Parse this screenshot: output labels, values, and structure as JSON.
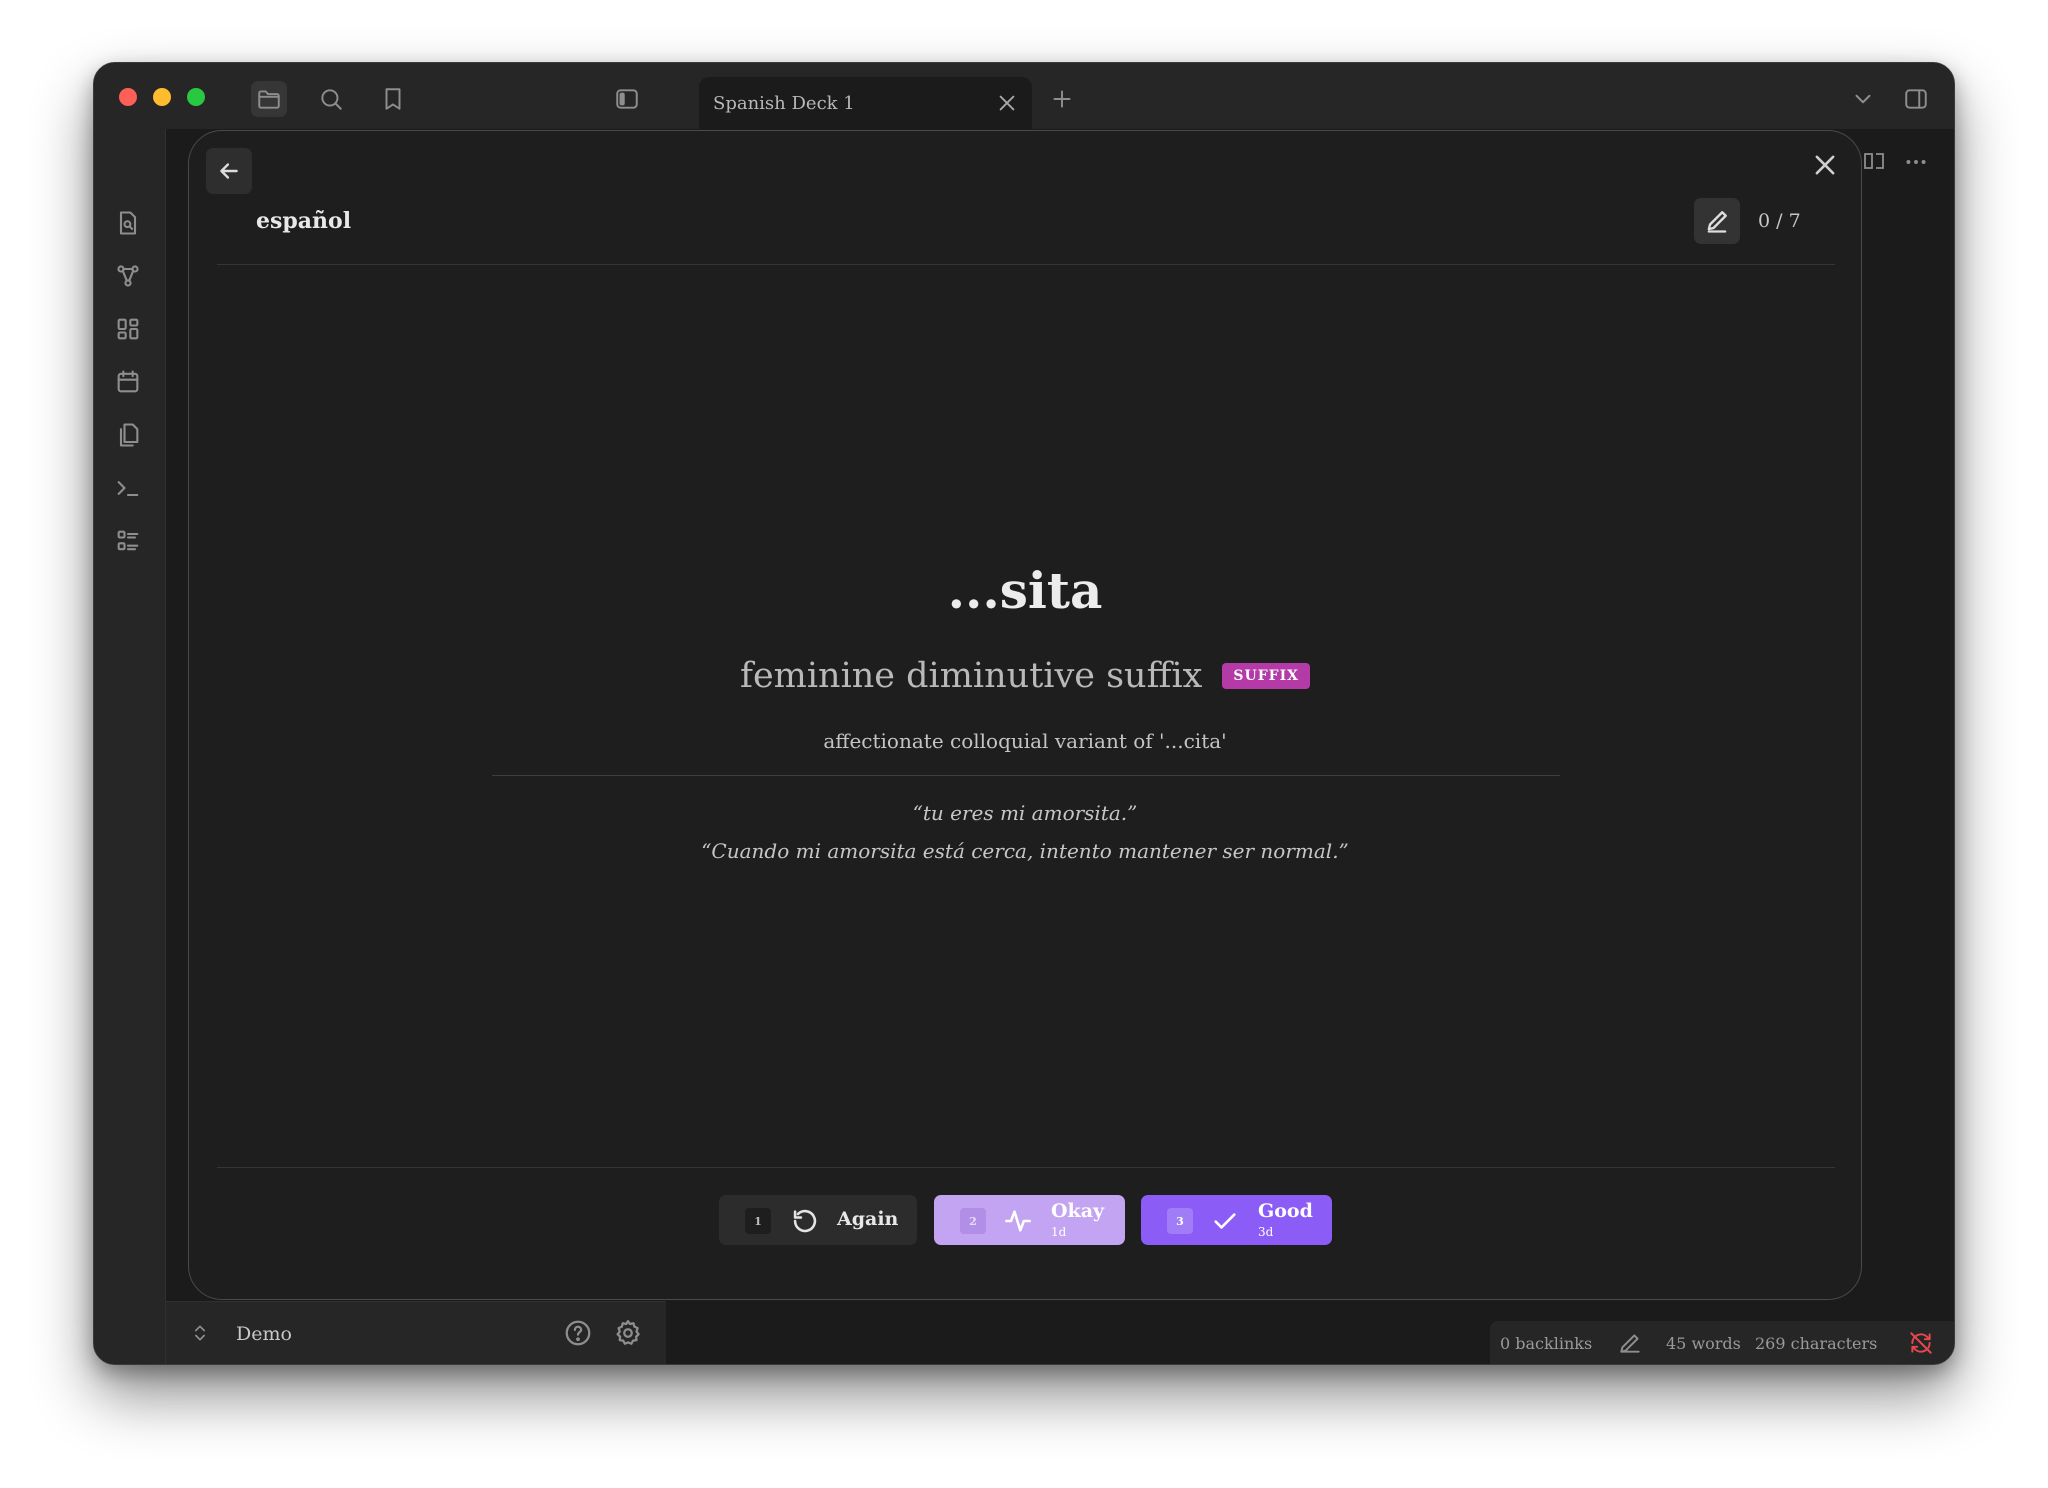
{
  "tab": {
    "title": "Spanish Deck 1"
  },
  "modal": {
    "deck_name": "español",
    "progress": "0 / 7"
  },
  "card": {
    "front": "...sita",
    "definition": "feminine diminutive suffix",
    "part_of_speech": "SUFFIX",
    "note": "affectionate colloquial variant of '...cita'",
    "examples": [
      "“tu eres mi amorsita.”",
      "“Cuando mi amorsita está cerca, intento mantener ser normal.”"
    ]
  },
  "ratings": [
    {
      "key": "1",
      "label": "Again",
      "interval": "",
      "icon": "rotate-ccw-icon"
    },
    {
      "key": "2",
      "label": "Okay",
      "interval": "1d",
      "icon": "activity-icon"
    },
    {
      "key": "3",
      "label": "Good",
      "interval": "3d",
      "icon": "check-icon"
    }
  ],
  "vault": {
    "name": "Demo"
  },
  "status": {
    "backlinks": "0 backlinks",
    "words": "45 words",
    "characters": "269 characters"
  },
  "colors": {
    "accent": "#8b5cf6",
    "accent_light": "#c3a4f2",
    "badge": "#b43aa8",
    "sync_error": "#e5484d"
  }
}
